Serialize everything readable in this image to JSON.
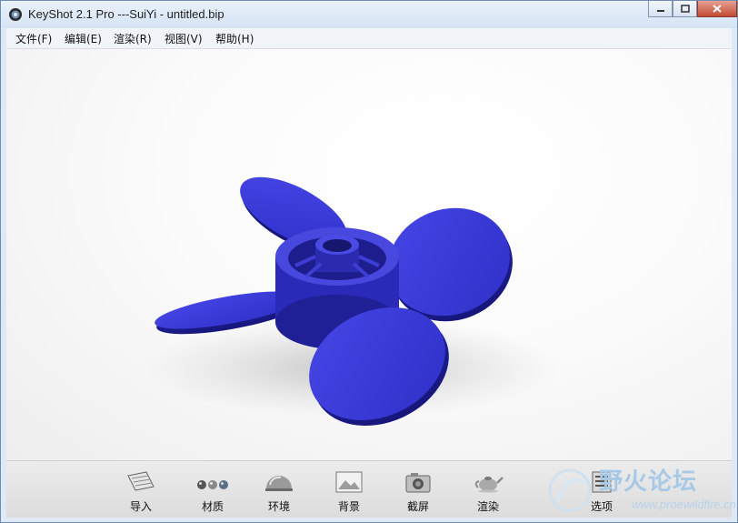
{
  "window": {
    "title": "KeyShot 2.1 Pro ---SuiYi - untitled.bip"
  },
  "menu": [
    {
      "label": "文件(F)"
    },
    {
      "label": "编辑(E)"
    },
    {
      "label": "渲染(R)"
    },
    {
      "label": "视图(V)"
    },
    {
      "label": "帮助(H)"
    }
  ],
  "viewport": {
    "model_color": "#3a3ad6",
    "background": "#f4f4f4"
  },
  "toolbar": {
    "items": [
      {
        "label": "导入",
        "icon": "import-icon"
      },
      {
        "label": "材质",
        "icon": "material-spheres-icon"
      },
      {
        "label": "环境",
        "icon": "environment-dome-icon"
      },
      {
        "label": "背景",
        "icon": "background-image-icon"
      },
      {
        "label": "截屏",
        "icon": "camera-icon"
      },
      {
        "label": "渲染",
        "icon": "teapot-icon"
      },
      {
        "label": "选项",
        "icon": "options-icon"
      }
    ]
  },
  "watermark": {
    "name": "野火论坛",
    "url": "www.proewildfire.cn"
  }
}
